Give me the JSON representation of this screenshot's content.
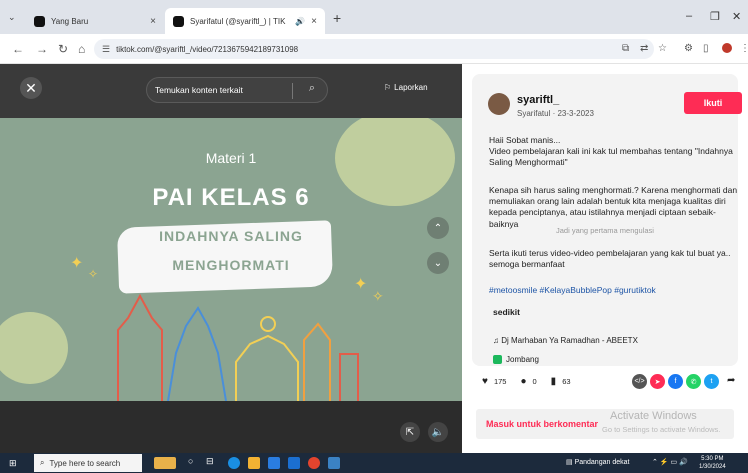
{
  "browser": {
    "tabs": [
      {
        "title": "Yang Baru",
        "close": "×"
      },
      {
        "title": "Syarifatul (@syariftl_) | TIK",
        "close": "×"
      }
    ],
    "new_tab": "+",
    "url": "tiktok.com/@syariftl_/video/7213675942189731098",
    "minimize": "–",
    "restore": "❐",
    "close": "✕"
  },
  "video": {
    "close_glyph": "✕",
    "search_placeholder": "Temukan konten terkait",
    "report_label": "Laporkan",
    "slide": {
      "subtitle": "Materi 1",
      "title": "PAI KELAS 6",
      "topic_line1": "INDAHNYA SALING",
      "topic_line2": "MENGHORMATI"
    }
  },
  "post": {
    "username": "syariftl_",
    "subtitle": "Syarifatul · 23-3-2023",
    "follow_label": "Ikuti",
    "desc1": "Haii Sobat manis...\nVideo pembelajaran kali ini kak tul membahas tentang \"Indahnya Saling Menghormati\"",
    "desc2": "Kenapa sih harus saling menghormati.? Karena menghormati dan memuliakan orang lain adalah bentuk kita menjaga kualitas diri kepada penciptanya, atau istilahnya menjadi ciptaan sebaik-baiknya",
    "overlay_note": "Jadi yang pertama mengulasi",
    "desc3": "Serta ikuti terus video-video pembelajaran yang kak tul buat ya..\nsemoga bermanfaat",
    "hashtags": "#metoosmile #KelayaBubblePop #gurutiktok",
    "more_label": "sedikit",
    "music": "Dj Marhaban Ya Ramadhan - ABEETX",
    "location": "Jombang",
    "likes": "175",
    "comments": "0",
    "saves": "63"
  },
  "comment_bar": {
    "login_prompt": "Masuk untuk berkomentar",
    "activate_title": "Activate Windows",
    "activate_sub": "Go to Settings to activate Windows."
  },
  "taskbar": {
    "search_placeholder": "Type here to search",
    "tray_label": "Pandangan dekat",
    "time": "5:30 PM",
    "date": "1/30/2024"
  },
  "colors": {
    "accent": "#fe2c55",
    "slide_bg": "#8ba491",
    "hashtag": "#1e55a6"
  }
}
